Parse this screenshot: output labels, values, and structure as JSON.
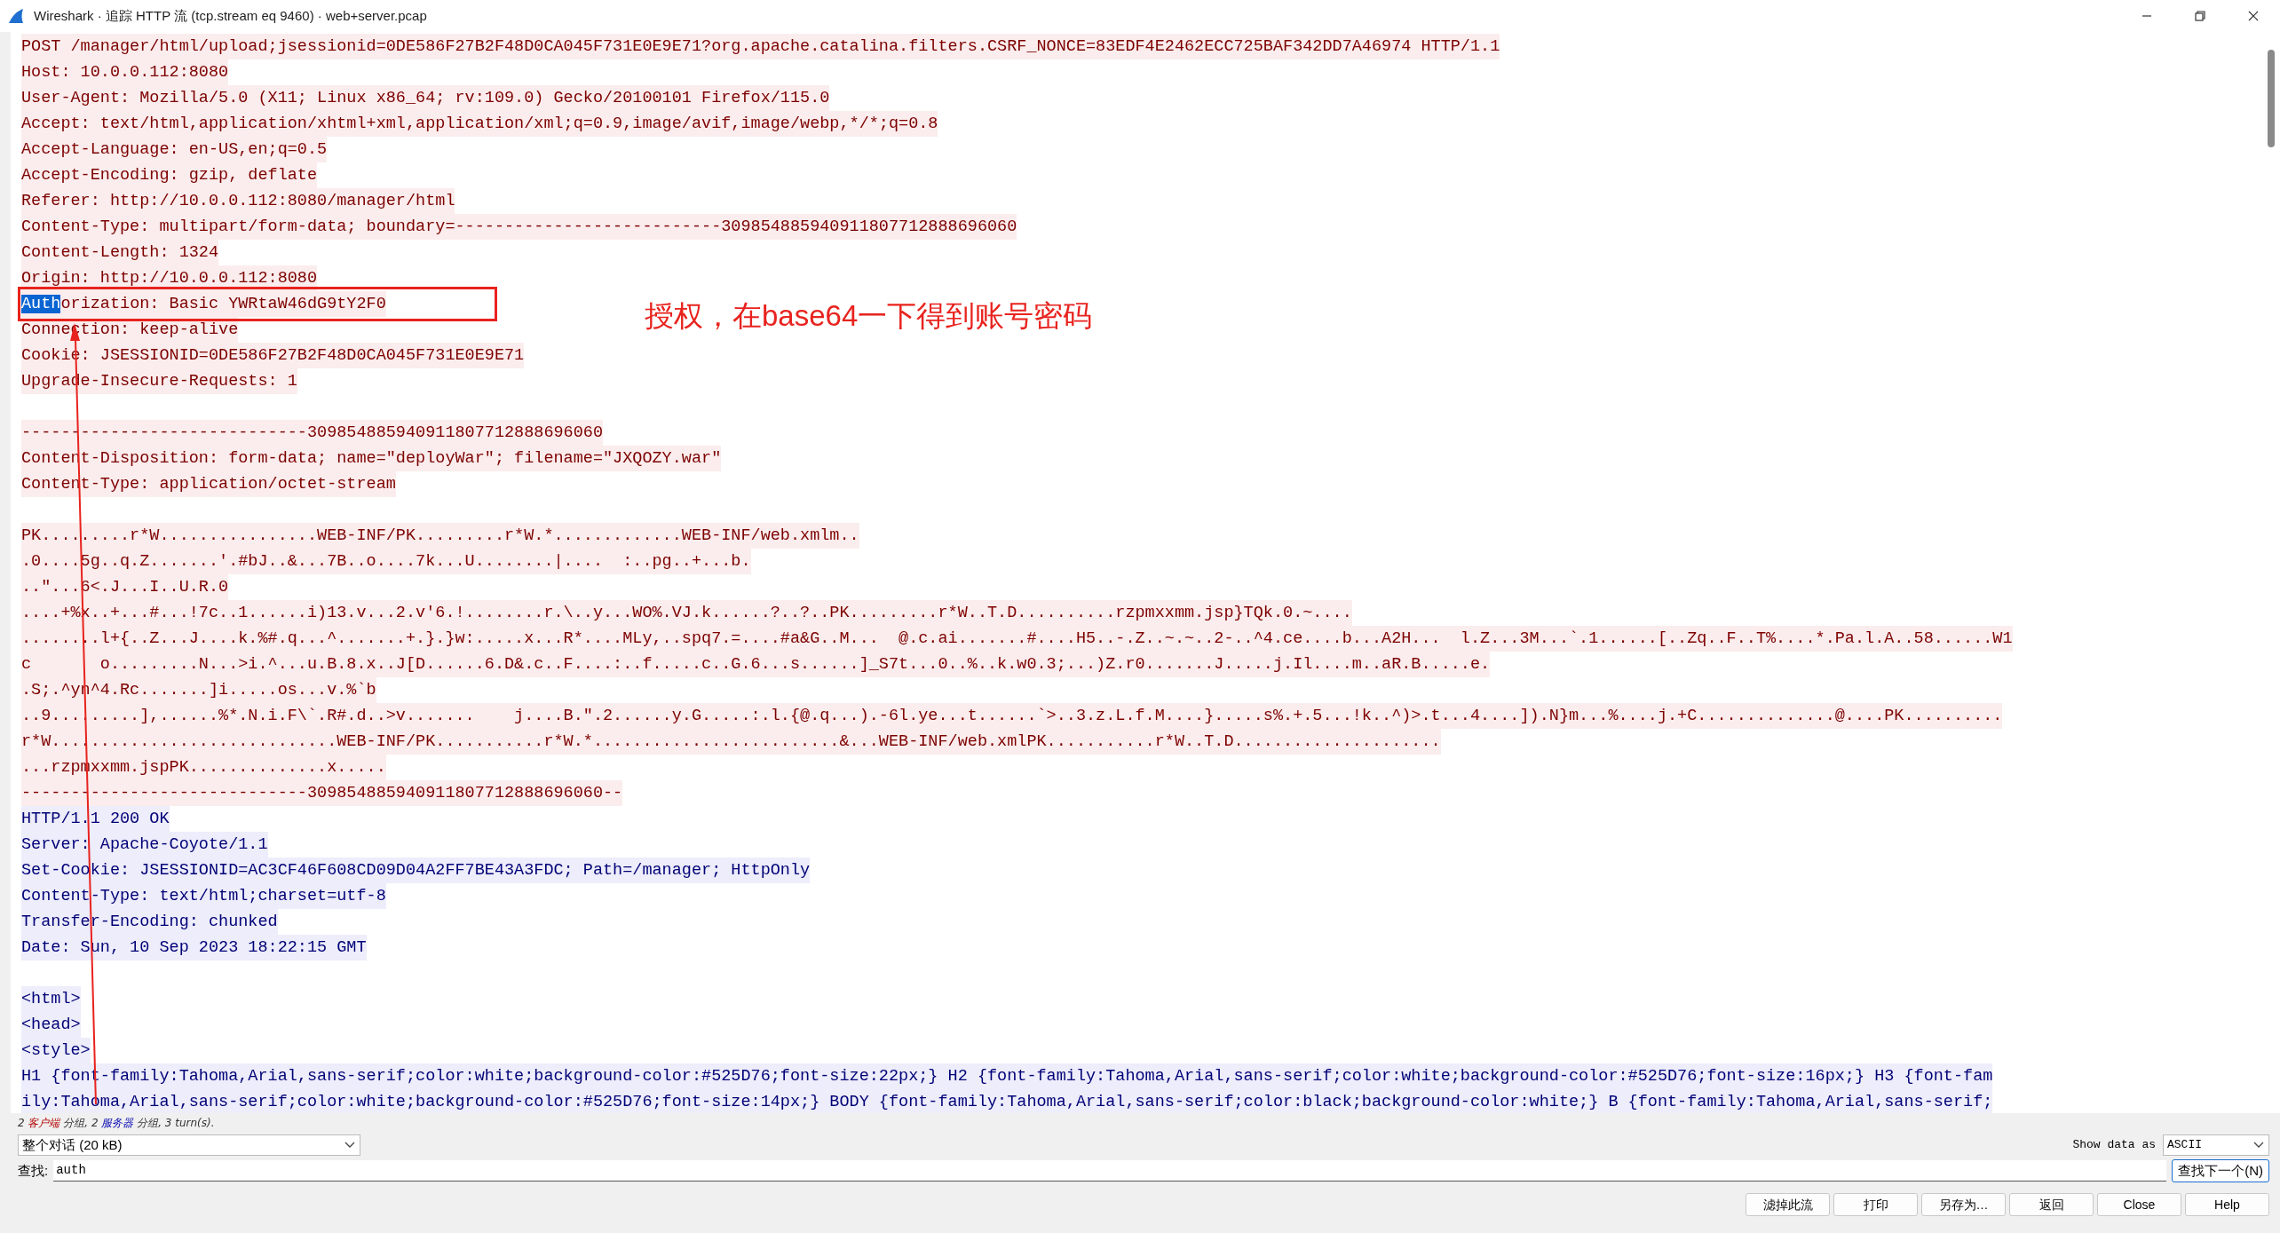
{
  "window": {
    "title": "Wireshark · 追踪 HTTP 流 (tcp.stream eq 9460) · web+server.pcap"
  },
  "stream": [
    {
      "kind": "client",
      "text": "POST /manager/html/upload;jsessionid=0DE586F27B2F48D0CA045F731E0E9E71?org.apache.catalina.filters.CSRF_NONCE=83EDF4E2462ECC725BAF342DD7A46974 HTTP/1.1"
    },
    {
      "kind": "client",
      "text": "Host: 10.0.0.112:8080"
    },
    {
      "kind": "client",
      "text": "User-Agent: Mozilla/5.0 (X11; Linux x86_64; rv:109.0) Gecko/20100101 Firefox/115.0"
    },
    {
      "kind": "client",
      "text": "Accept: text/html,application/xhtml+xml,application/xml;q=0.9,image/avif,image/webp,*/*;q=0.8"
    },
    {
      "kind": "client",
      "text": "Accept-Language: en-US,en;q=0.5"
    },
    {
      "kind": "client",
      "text": "Accept-Encoding: gzip, deflate"
    },
    {
      "kind": "client",
      "text": "Referer: http://10.0.0.112:8080/manager/html"
    },
    {
      "kind": "client",
      "text": "Content-Type: multipart/form-data; boundary=---------------------------309854885940911807712888696060"
    },
    {
      "kind": "client",
      "text": "Content-Length: 1324"
    },
    {
      "kind": "client",
      "text": "Origin: http://10.0.0.112:8080"
    },
    {
      "kind": "client",
      "segments": [
        {
          "text": "Auth",
          "selected": true
        },
        {
          "text": "orization: Basic YWRtaW46dG9tY2F0",
          "selected": false
        }
      ]
    },
    {
      "kind": "client",
      "text": "Connection: keep-alive"
    },
    {
      "kind": "client",
      "text": "Cookie: JSESSIONID=0DE586F27B2F48D0CA045F731E0E9E71"
    },
    {
      "kind": "client",
      "text": "Upgrade-Insecure-Requests: 1"
    },
    {
      "kind": "blank"
    },
    {
      "kind": "client",
      "text": "-----------------------------309854885940911807712888696060"
    },
    {
      "kind": "client",
      "text": "Content-Disposition: form-data; name=\"deployWar\"; filename=\"JXQOZY.war\""
    },
    {
      "kind": "client",
      "text": "Content-Type: application/octet-stream"
    },
    {
      "kind": "blank"
    },
    {
      "kind": "client",
      "text": "PK.........r*W................WEB-INF/PK.........r*W.*.............WEB-INF/web.xmlm.."
    },
    {
      "kind": "client",
      "text": ".0....5g..q.Z.......'.#bJ..&...7B..o....7k...U........|....  :..pg..+...b."
    },
    {
      "kind": "client",
      "text": "..\"...6<.J...I..U.R.0"
    },
    {
      "kind": "client",
      "text": "....+%x..+...#...!7c..1......i)13.v...2.v'6.!........r.\\..y...WO%.VJ.k......?..?..PK.........r*W..T.D..........rzpmxxmm.jsp}TQk.0.~...."
    },
    {
      "kind": "client",
      "text": "........l+{..Z...J....k.%#.q...^.......+.}.}w:.....x...R*....MLy,..spq7.=....#a&G..M...  @.c.ai.......#....H5..-.Z..~.~..2-..^4.ce....b...A2H...  l.Z...3M...`.1......[..Zq..F..T%....*.Pa.l.A..58......W1"
    },
    {
      "kind": "client",
      "text": "c       o.........N...>i.^...u.B.8.x..J[D......6.D&.c..F....:..f.....c..G.6...s......]_S7t...0..%..k.w0.3;...)Z.r0.......J.....j.Il....m..aR.B.....e."
    },
    {
      "kind": "client",
      "text": ".S;.^yn^4.Rc.......]i.....os...v.%`b"
    },
    {
      "kind": "client",
      "text": "..9.........],......%*.N.i.F\\`.R#.d..>v.......    j....B.\".2......y.G.....:.l.{@.q...).-6l.ye...t......`>..3.z.L.f.M....}.....s%.+.5...!k..^)>.t...4....]).N}m...%....j.+C..............@....PK.........."
    },
    {
      "kind": "client",
      "text": "r*W.............................WEB-INF/PK...........r*W.*.........................&...WEB-INF/web.xmlPK...........r*W..T.D....................."
    },
    {
      "kind": "client",
      "text": "...rzpmxxmm.jspPK..............x....."
    },
    {
      "kind": "client",
      "text": "-----------------------------309854885940911807712888696060--"
    },
    {
      "kind": "server",
      "text": "HTTP/1.1 200 OK"
    },
    {
      "kind": "server",
      "text": "Server: Apache-Coyote/1.1"
    },
    {
      "kind": "server",
      "text": "Set-Cookie: JSESSIONID=AC3CF46F608CD09D04A2FF7BE43A3FDC; Path=/manager; HttpOnly"
    },
    {
      "kind": "server",
      "text": "Content-Type: text/html;charset=utf-8"
    },
    {
      "kind": "server",
      "text": "Transfer-Encoding: chunked"
    },
    {
      "kind": "server",
      "text": "Date: Sun, 10 Sep 2023 18:22:15 GMT"
    },
    {
      "kind": "blank"
    },
    {
      "kind": "server",
      "text": "<html>"
    },
    {
      "kind": "server",
      "text": "<head>"
    },
    {
      "kind": "server",
      "text": "<style>"
    },
    {
      "kind": "server",
      "text": "H1 {font-family:Tahoma,Arial,sans-serif;color:white;background-color:#525D76;font-size:22px;} H2 {font-family:Tahoma,Arial,sans-serif;color:white;background-color:#525D76;font-size:16px;} H3 {font-fam"
    },
    {
      "kind": "server",
      "text": "ily:Tahoma,Arial,sans-serif;color:white;background-color:#525D76;font-size:14px;} BODY {font-family:Tahoma,Arial,sans-serif;color:black;background-color:white;} B {font-family:Tahoma,Arial,sans-serif;"
    }
  ],
  "annotation": {
    "note": "授权，在base64一下得到账号密码"
  },
  "summary": [
    {
      "kind": "plain",
      "text": "2 "
    },
    {
      "kind": "client",
      "text": "客户端"
    },
    {
      "kind": "plain",
      "text": " 分组, 2 "
    },
    {
      "kind": "server",
      "text": "服务器"
    },
    {
      "kind": "plain",
      "text": " 分组, 3 turn(s)."
    }
  ],
  "conversation_select": {
    "value": "整个对话 (20 kB)"
  },
  "show_data_as": {
    "label": "Show data as",
    "value": "ASCII"
  },
  "find": {
    "label": "查找:",
    "value": "auth",
    "button": "查找下一个(N)"
  },
  "buttons": [
    "滤掉此流",
    "打印",
    "另存为…",
    "返回",
    "Close",
    "Help"
  ]
}
